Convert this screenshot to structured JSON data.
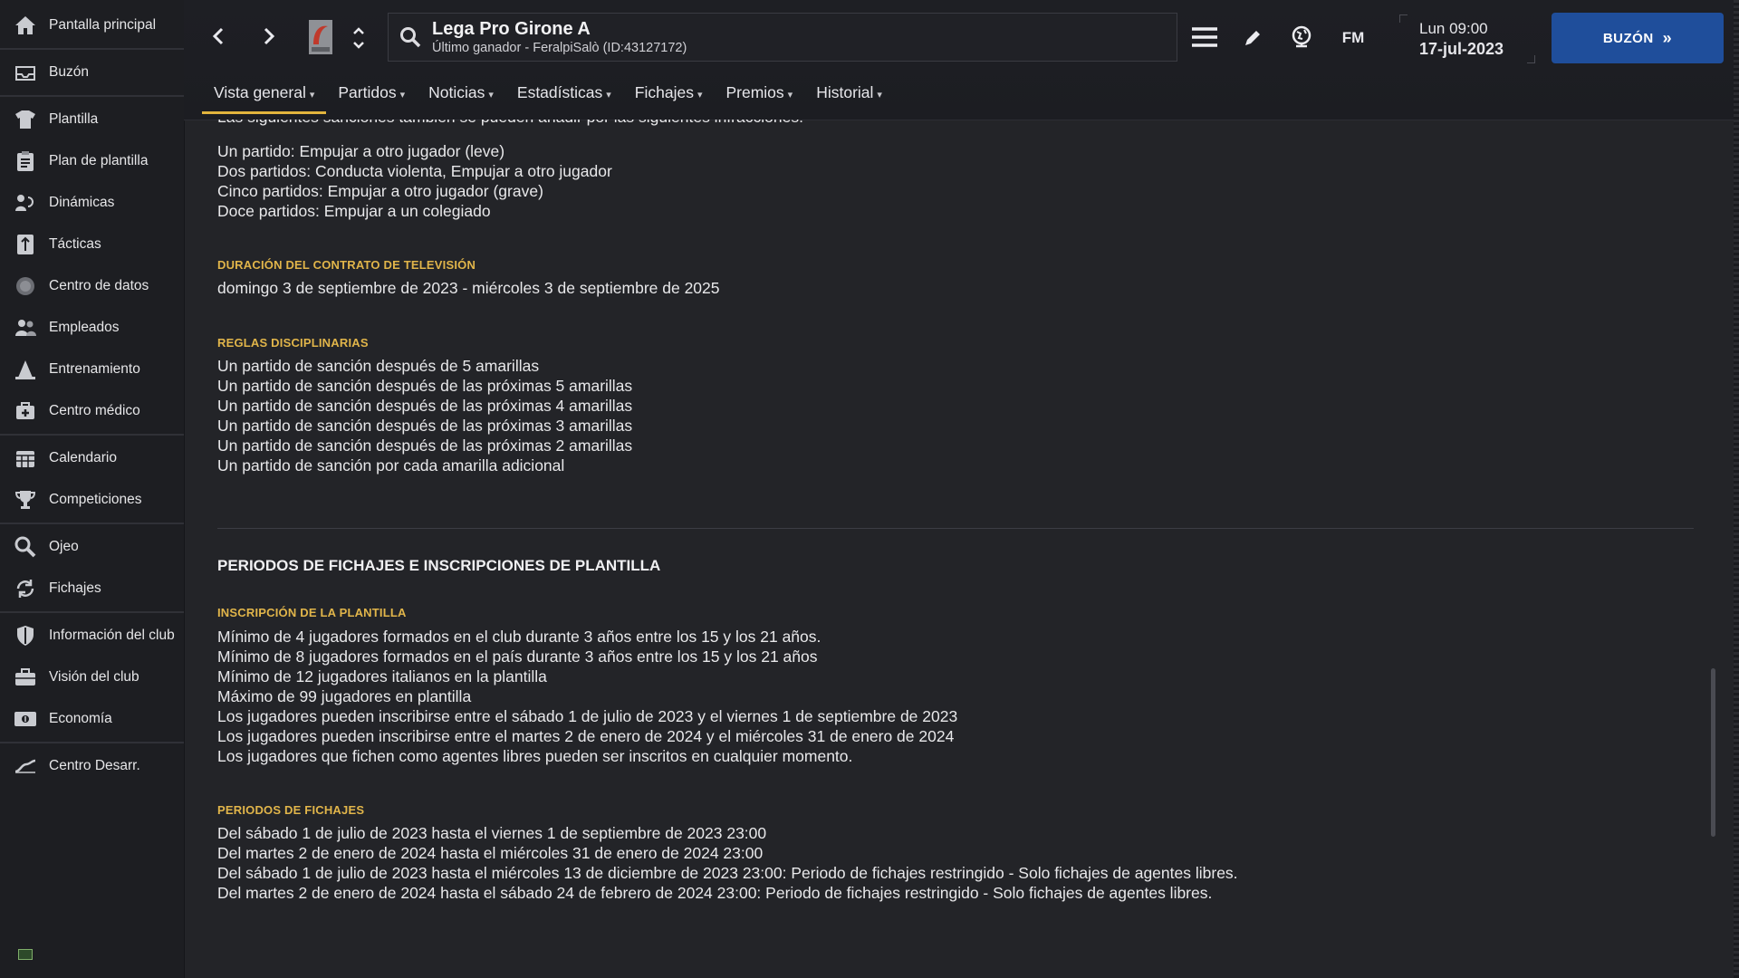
{
  "sidebar": {
    "items": [
      {
        "label": "Pantalla principal",
        "icon": "home-icon"
      },
      {
        "label": "Buzón",
        "icon": "inbox-icon"
      },
      {
        "label": "Plantilla",
        "icon": "shirt-icon"
      },
      {
        "label": "Plan de plantilla",
        "icon": "clipboard-icon"
      },
      {
        "label": "Dinámicas",
        "icon": "dynamics-icon"
      },
      {
        "label": "Tácticas",
        "icon": "tactics-icon"
      },
      {
        "label": "Centro de datos",
        "icon": "data-icon"
      },
      {
        "label": "Empleados",
        "icon": "staff-icon"
      },
      {
        "label": "Entrenamiento",
        "icon": "training-icon"
      },
      {
        "label": "Centro médico",
        "icon": "medical-icon"
      },
      {
        "label": "Calendario",
        "icon": "calendar-icon"
      },
      {
        "label": "Competiciones",
        "icon": "trophy-icon"
      },
      {
        "label": "Ojeo",
        "icon": "scout-icon"
      },
      {
        "label": "Fichajes",
        "icon": "transfer-icon"
      },
      {
        "label": "Información del club",
        "icon": "shield-icon"
      },
      {
        "label": "Visión del club",
        "icon": "briefcase-icon"
      },
      {
        "label": "Economía",
        "icon": "money-icon"
      },
      {
        "label": "Centro Desarr.",
        "icon": "development-icon"
      }
    ]
  },
  "header": {
    "title": "Lega Pro Girone A",
    "subtitle": "Último ganador - FeralpiSalò (ID:43127172)",
    "time": "Lun 09:00",
    "date": "17-jul-2023",
    "fm_label": "FM",
    "inbox_button": "BUZÓN"
  },
  "tabs": [
    {
      "label": "Vista general"
    },
    {
      "label": "Partidos"
    },
    {
      "label": "Noticias"
    },
    {
      "label": "Estadísticas"
    },
    {
      "label": "Fichajes"
    },
    {
      "label": "Premios"
    },
    {
      "label": "Historial"
    }
  ],
  "content": {
    "partial_line": "Las siguientes sanciones también se pueden añadir por las siguientes infracciones:",
    "sanctions": [
      "Un partido: Empujar a otro jugador (leve)",
      "Dos partidos: Conducta violenta, Empujar a otro jugador",
      "Cinco partidos: Empujar a otro jugador (grave)",
      "Doce partidos: Empujar a un colegiado"
    ],
    "tv_heading": "DURACIÓN DEL CONTRATO DE TELEVISIÓN",
    "tv_text": "domingo 3 de septiembre de 2023 - miércoles 3 de septiembre de 2025",
    "disc_heading": "REGLAS DISCIPLINARIAS",
    "disc_rules": [
      "Un partido de sanción después de 5 amarillas",
      "Un partido de sanción después de las próximas 5 amarillas",
      "Un partido de sanción después de las próximas 4 amarillas",
      "Un partido de sanción después de las próximas 3 amarillas",
      "Un partido de sanción después de las próximas 2 amarillas",
      "Un partido de sanción por cada amarilla adicional"
    ],
    "section_title": "PERIODOS DE FICHAJES E INSCRIPCIONES DE PLANTILLA",
    "reg_heading": "INSCRIPCIÓN DE LA PLANTILLA",
    "reg_lines": [
      "Mínimo de 4 jugadores formados en el club durante 3 años entre los 15 y los 21 años.",
      "Mínimo de 8 jugadores formados en el país durante 3 años entre los 15 y los 21 años",
      "Mínimo de 12 jugadores italianos en la plantilla",
      "Máximo de 99 jugadores en plantilla",
      "Los jugadores pueden inscribirse entre el sábado 1 de julio de 2023 y el viernes 1 de septiembre de 2023",
      "Los jugadores pueden inscribirse entre el martes 2 de enero de 2024 y el miércoles 31 de enero de 2024",
      "Los jugadores que fichen como agentes libres pueden ser inscritos en cualquier momento."
    ],
    "windows_heading": "PERIODOS DE FICHAJES",
    "windows_lines": [
      "Del sábado 1 de julio de 2023 hasta el viernes 1 de septiembre de 2023 23:00",
      "Del martes 2 de enero de 2024 hasta el miércoles 31 de enero de 2024 23:00",
      "Del sábado 1 de julio de 2023 hasta el miércoles 13 de diciembre de 2023 23:00: Periodo de fichajes restringido - Solo fichajes de agentes libres.",
      "Del martes 2 de enero de 2024 hasta el sábado 24 de febrero de 2024 23:00: Periodo de fichajes restringido - Solo fichajes de agentes libres."
    ]
  },
  "colors": {
    "accent": "#e2b43d",
    "button": "#1f4e9b",
    "background": "#232428"
  }
}
